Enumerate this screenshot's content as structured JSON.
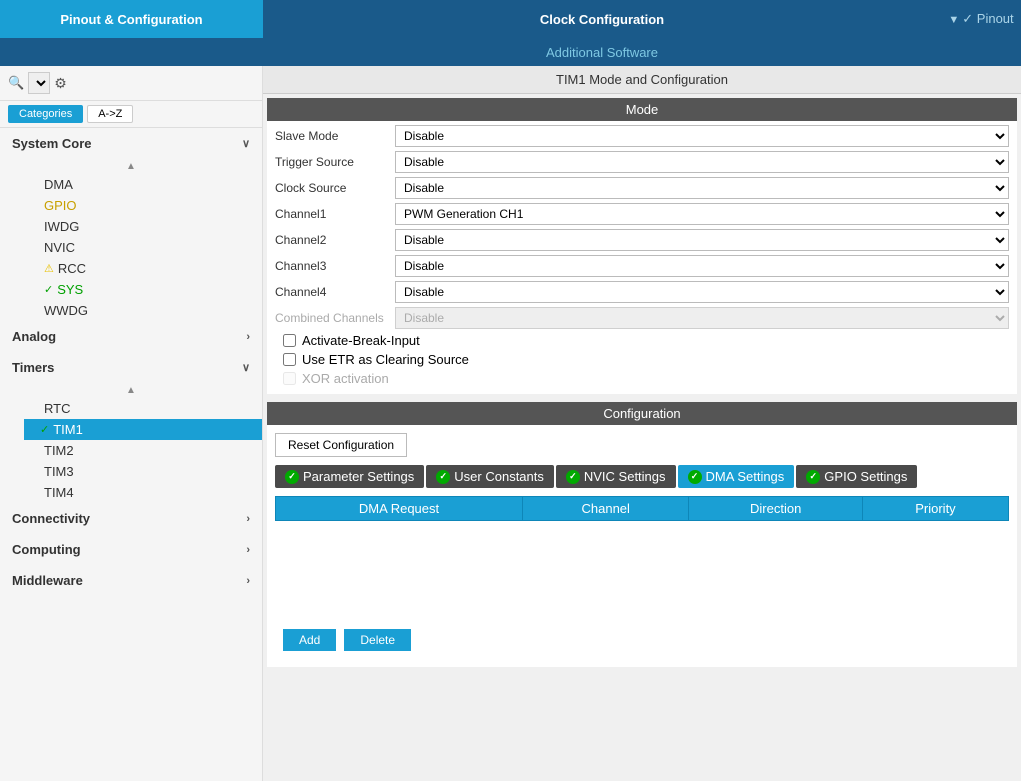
{
  "header": {
    "pinout_label": "Pinout & Configuration",
    "clock_label": "Clock Configuration",
    "additional_label": "Additional Software",
    "pinout_short": "✓ Pinout"
  },
  "secondary": {
    "title": "TIM1 Mode and Configuration"
  },
  "sidebar": {
    "search_placeholder": "",
    "categories_label": "Categories",
    "az_label": "A->Z",
    "sections": [
      {
        "name": "System Core",
        "expanded": true,
        "items": [
          {
            "label": "DMA",
            "color": "normal",
            "status": ""
          },
          {
            "label": "GPIO",
            "color": "yellow",
            "status": ""
          },
          {
            "label": "IWDG",
            "color": "normal",
            "status": ""
          },
          {
            "label": "NVIC",
            "color": "normal",
            "status": ""
          },
          {
            "label": "RCC",
            "color": "normal",
            "status": "warn"
          },
          {
            "label": "SYS",
            "color": "green",
            "status": "check"
          },
          {
            "label": "WWDG",
            "color": "normal",
            "status": ""
          }
        ]
      },
      {
        "name": "Analog",
        "expanded": false,
        "items": []
      },
      {
        "name": "Timers",
        "expanded": true,
        "items": [
          {
            "label": "RTC",
            "color": "normal",
            "status": ""
          },
          {
            "label": "TIM1",
            "color": "normal",
            "status": "check",
            "active": true
          },
          {
            "label": "TIM2",
            "color": "normal",
            "status": ""
          },
          {
            "label": "TIM3",
            "color": "normal",
            "status": ""
          },
          {
            "label": "TIM4",
            "color": "normal",
            "status": ""
          }
        ]
      },
      {
        "name": "Connectivity",
        "expanded": false,
        "items": []
      },
      {
        "name": "Computing",
        "expanded": false,
        "items": []
      },
      {
        "name": "Middleware",
        "expanded": false,
        "items": []
      }
    ]
  },
  "mode_section": {
    "header": "Mode",
    "fields": [
      {
        "label": "Slave Mode",
        "value": "Disable",
        "disabled": false
      },
      {
        "label": "Trigger Source",
        "value": "Disable",
        "disabled": false
      },
      {
        "label": "Clock Source",
        "value": "Disable",
        "disabled": false
      },
      {
        "label": "Channel1",
        "value": "PWM Generation CH1",
        "disabled": false
      },
      {
        "label": "Channel2",
        "value": "Disable",
        "disabled": false
      },
      {
        "label": "Channel3",
        "value": "Disable",
        "disabled": false
      },
      {
        "label": "Channel4",
        "value": "Disable",
        "disabled": false
      },
      {
        "label": "Combined Channels",
        "value": "Disable",
        "disabled": true
      }
    ],
    "checkboxes": [
      {
        "label": "Activate-Break-Input",
        "checked": false,
        "disabled": false
      },
      {
        "label": "Use ETR as Clearing Source",
        "checked": false,
        "disabled": false
      },
      {
        "label": "XOR activation",
        "checked": false,
        "disabled": true
      }
    ]
  },
  "config_section": {
    "header": "Configuration",
    "reset_btn_label": "Reset Configuration",
    "tabs": [
      {
        "label": "Parameter Settings",
        "active": false
      },
      {
        "label": "User Constants",
        "active": false
      },
      {
        "label": "NVIC Settings",
        "active": false
      },
      {
        "label": "DMA Settings",
        "active": true
      },
      {
        "label": "GPIO Settings",
        "active": false
      }
    ],
    "dma_table": {
      "columns": [
        "DMA Request",
        "Channel",
        "Direction",
        "Priority"
      ],
      "rows": []
    },
    "add_label": "Add",
    "delete_label": "Delete"
  }
}
